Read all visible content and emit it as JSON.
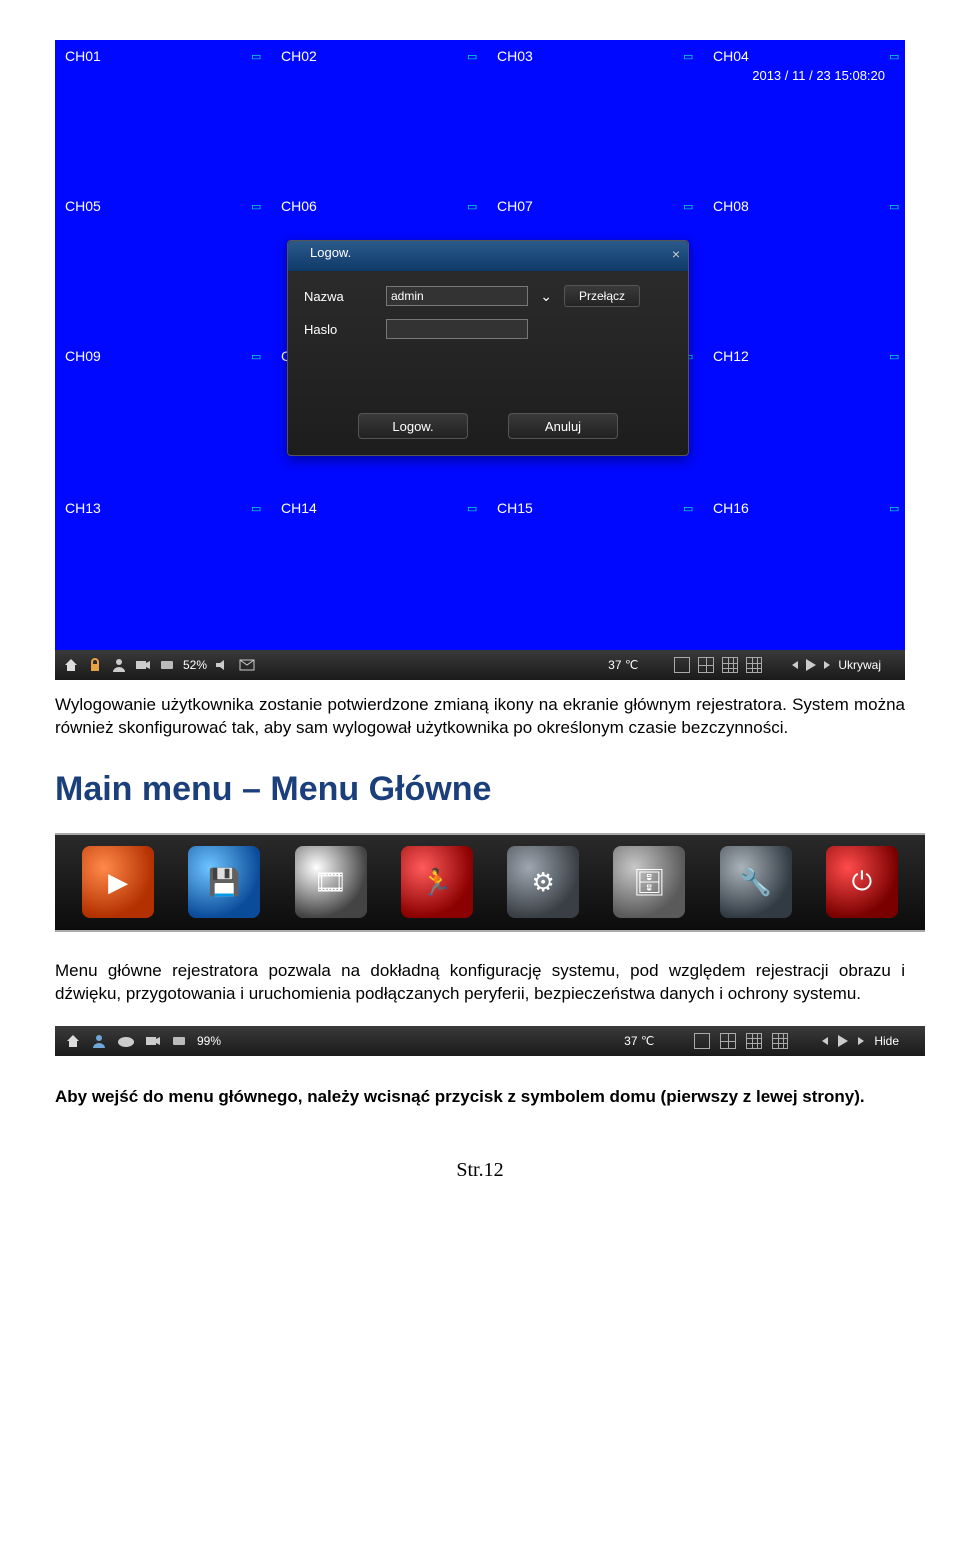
{
  "dvr": {
    "channels": [
      "CH01",
      "CH02",
      "CH03",
      "CH04",
      "CH05",
      "CH06",
      "CH07",
      "CH08",
      "CH09",
      "CH",
      "CH12",
      "CH13",
      "CH14",
      "CH15",
      "CH16"
    ],
    "datetime": "2013 / 11 / 23  15:08:20",
    "dialog": {
      "title": "Logow.",
      "name_label": "Nazwa",
      "name_value": "admin",
      "password_label": "Haslo",
      "password_value": "",
      "switch_btn": "Przełącz",
      "ok_btn": "Logow.",
      "cancel_btn": "Anuluj"
    },
    "taskbar": {
      "percent": "52%",
      "temp": "37 ℃",
      "hide": "Ukrywaj"
    }
  },
  "text": {
    "para1": "Wylogowanie użytkownika zostanie potwierdzone zmianą ikony na ekranie głównym rejestratora. System można również skonfigurować tak, aby sam wylogował użytkownika po określonym czasie bezczynności.",
    "heading": "Main menu – Menu Główne",
    "para2": "Menu główne rejestratora pozwala na dokładną konfigurację systemu, pod względem rejestracji obrazu i dźwięku, przygotowania i uruchomienia podłączanych peryferii, bezpieczeństwa danych i ochrony systemu.",
    "para3": "Aby wejść do menu głównego, należy wcisnąć przycisk z symbolem domu (pierwszy z lewej strony).",
    "page": "Str.12"
  },
  "taskbar2": {
    "percent": "99%",
    "temp": "37 ℃",
    "hide": "Hide"
  }
}
